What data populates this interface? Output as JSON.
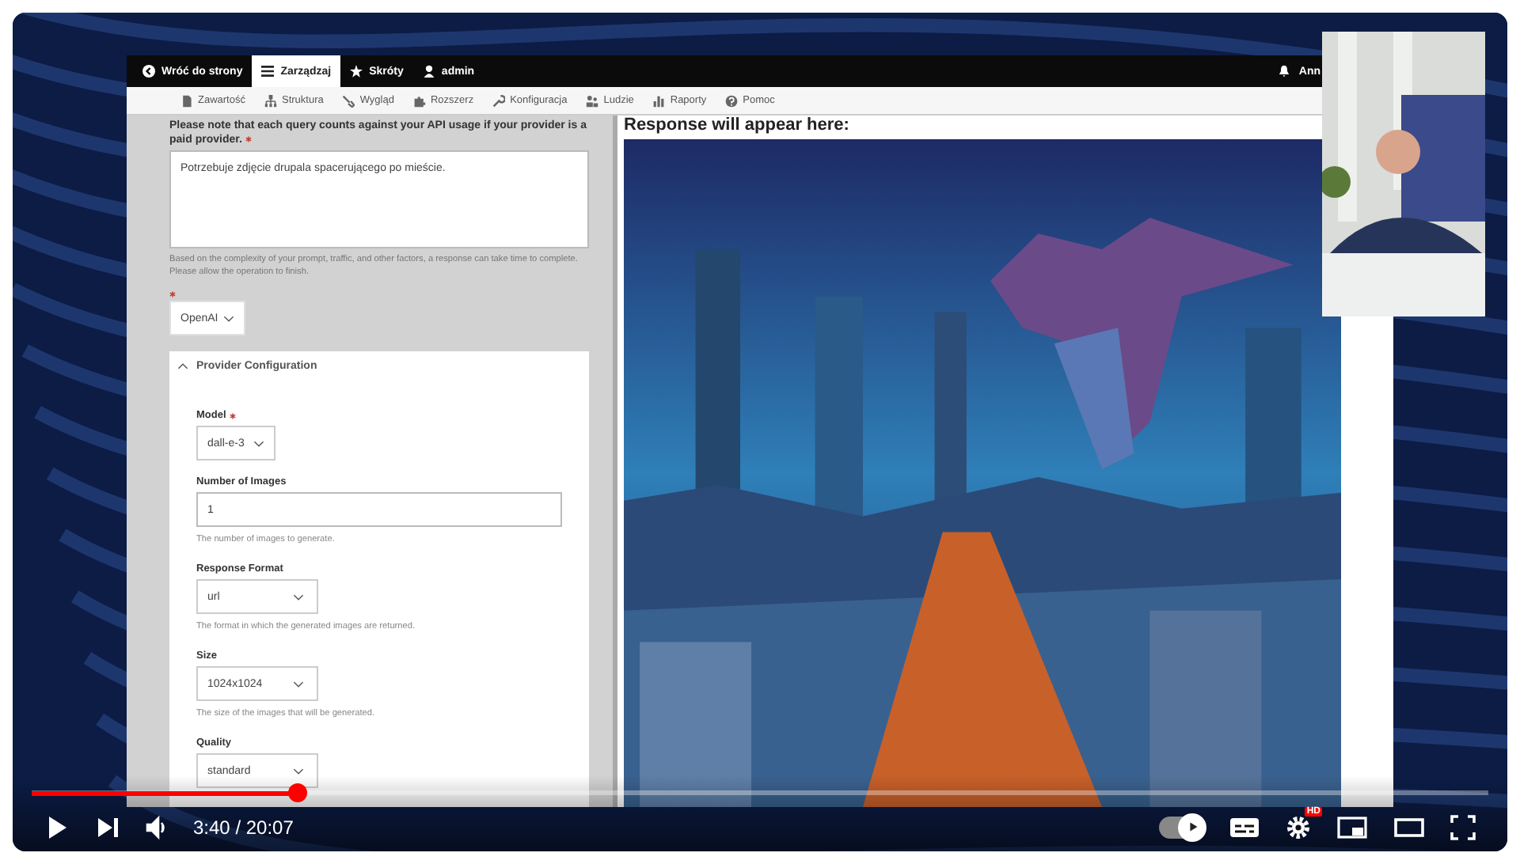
{
  "toolbar": {
    "items": [
      {
        "label": "Wróć do strony",
        "selected": false
      },
      {
        "label": "Zarządzaj",
        "selected": true
      },
      {
        "label": "Skróty",
        "selected": false
      },
      {
        "label": "admin",
        "selected": false
      }
    ],
    "user": "Ann"
  },
  "menu": [
    {
      "label": "Zawartość"
    },
    {
      "label": "Struktura"
    },
    {
      "label": "Wygląd"
    },
    {
      "label": "Rozszerz"
    },
    {
      "label": "Konfiguracja"
    },
    {
      "label": "Ludzie"
    },
    {
      "label": "Raporty"
    },
    {
      "label": "Pomoc"
    }
  ],
  "form": {
    "prompt_label": "Please note that each query counts against your API usage if your provider is a paid provider.",
    "prompt_required": true,
    "prompt_value": "Potrzebuje zdjęcie drupala spacerującego po mieście.",
    "prompt_help": "Based on the complexity of your prompt, traffic, and other factors, a response can take time to complete. Please allow the operation to finish.",
    "provider_required": true,
    "provider": "OpenAI",
    "section": {
      "title": "Provider Configuration",
      "expanded": true,
      "fields": [
        {
          "kind": "select",
          "label": "Model",
          "required": true,
          "value": "dall-e-3"
        },
        {
          "kind": "text",
          "label": "Number of Images",
          "required": false,
          "value": "1",
          "help": "The number of images to generate."
        },
        {
          "kind": "select",
          "label": "Response Format",
          "required": false,
          "value": "url",
          "help": "The format in which the generated images are returned."
        },
        {
          "kind": "select",
          "label": "Size",
          "required": false,
          "value": "1024x1024",
          "help": "The size of the images that will be generated."
        },
        {
          "kind": "select",
          "label": "Quality",
          "required": false,
          "value": "standard"
        }
      ]
    }
  },
  "response": {
    "heading": "Response will appear here:"
  },
  "player": {
    "progress": {
      "level": 0.183
    },
    "time": "3:40 / 20:07",
    "playing": false,
    "autoplay": true,
    "quality_badge": "HD"
  }
}
